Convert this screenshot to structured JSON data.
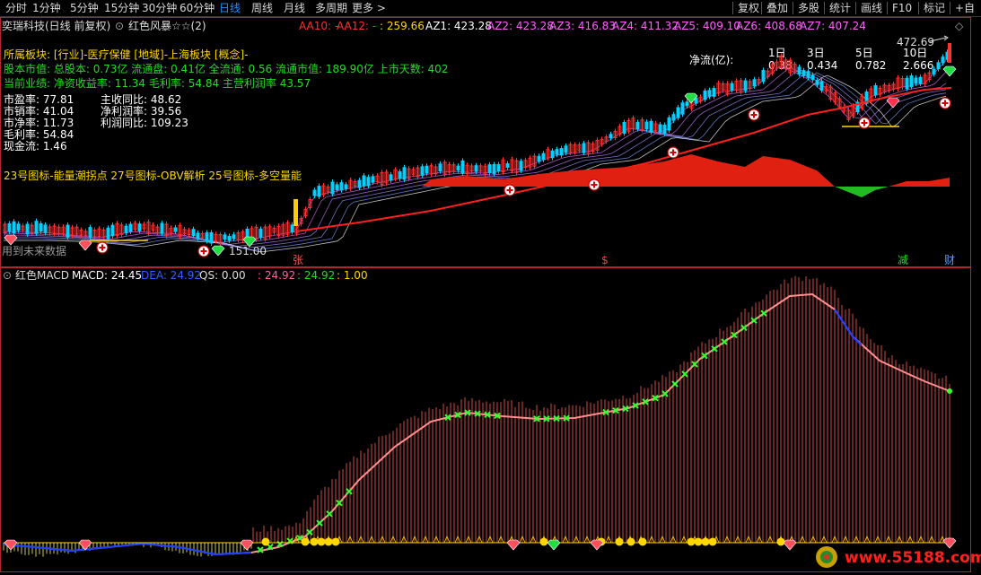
{
  "toolbar": {
    "left": [
      {
        "label": "分时",
        "active": false
      },
      {
        "label": "1分钟",
        "active": false
      },
      {
        "label": "5分钟",
        "active": false
      },
      {
        "label": "15分钟",
        "active": false
      },
      {
        "label": "30分钟",
        "active": false
      },
      {
        "label": "60分钟",
        "active": false
      },
      {
        "label": "日线",
        "active": true
      },
      {
        "label": "周线",
        "active": false
      },
      {
        "label": "月线",
        "active": false
      },
      {
        "label": "多周期",
        "active": false
      },
      {
        "label": "更多 >",
        "active": false
      }
    ],
    "right": [
      "复权",
      "叠加",
      "多股",
      "统计",
      "画线",
      "F10",
      "标记",
      "+自"
    ]
  },
  "header": {
    "stock_title": "奕瑞科技(日线 前复权)",
    "formula_name": "红色风暴☆☆(2)",
    "aa10": "AA10: -",
    "aa12": "AA12: -",
    "price": ": 259.66",
    "az": [
      {
        "label": "AZ1: 423.28",
        "color": "#ffffff"
      },
      {
        "label": "AZ2: 423.28",
        "color": "#ff60ff"
      },
      {
        "label": "AZ3: 416.83",
        "color": "#ff60ff"
      },
      {
        "label": "AZ4: 411.32",
        "color": "#ff60ff"
      },
      {
        "label": "AZ5: 409.10",
        "color": "#ff60ff"
      },
      {
        "label": "AZ6: 408.68",
        "color": "#ff60ff"
      },
      {
        "label": "AZ7: 407.24",
        "color": "#ff60ff"
      }
    ]
  },
  "info": {
    "sector": "所属板块: [行业]-医疗保健 [地域]-上海板块 [概念]-",
    "capital": "股本市值: 总股本: 0.73亿 流通盘: 0.41亿 全流通: 0.56 流通市值: 189.90亿 上市天数: 402",
    "performance": "当前业绩:  净资收益率: 11.34 毛利率: 54.84 主营利润率 43.57",
    "ratios_left": [
      "市盈率: 77.81",
      "市销率: 41.04",
      "市净率: 11.73",
      "毛利率: 54.84",
      "现金流: 1.46"
    ],
    "ratios_right": [
      "主收同比: 48.62",
      "净利润率: 39.56",
      "利润同比: 109.23"
    ],
    "tips": "23号图标-能量潮拐点 27号图标-OBV解析 25号图标-多空量能"
  },
  "flow": {
    "title": "净流(亿):",
    "labels": [
      "1日",
      "3日",
      "5日",
      "10日"
    ],
    "values": [
      "0.38",
      "0.434",
      "0.782",
      "2.666"
    ]
  },
  "price_marks": {
    "high": "472.69",
    "low": "151.00"
  },
  "markers": {
    "zhang": "张",
    "dollar": "$",
    "jian": "减",
    "cai": "财",
    "used": "用到未来数据"
  },
  "macd": {
    "name": "红色MACD",
    "macd": "MACD: 24.45",
    "dea": "DEA: 24.92",
    "qs": "QS: 0.00",
    "v1": ": 24.92",
    "v2": ": 24.92",
    "v3": ": 1.00"
  },
  "colors": {
    "up": "#ff3030",
    "down": "#00d0ff",
    "ma": "#ff2020",
    "macd_bar": "#d84a3a",
    "dif": "#ff8c8c",
    "gold": "#ffd700",
    "green": "#22cc22"
  },
  "watermark": "www.55188.com"
}
